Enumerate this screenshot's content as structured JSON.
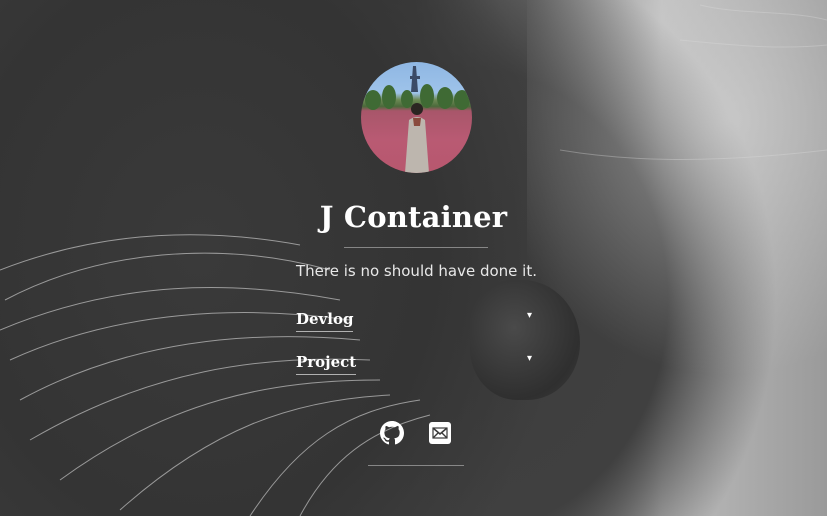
{
  "profile": {
    "name": "J Container",
    "tagline": "There is no should have done it."
  },
  "nav": {
    "items": [
      {
        "label": "Devlog",
        "caret": "▾"
      },
      {
        "label": "Project",
        "caret": "▾"
      }
    ]
  },
  "social": {
    "icons": [
      "github-icon",
      "mail-icon"
    ]
  },
  "colors": {
    "text": "#ffffff",
    "tagline": "#e8e8e8"
  }
}
